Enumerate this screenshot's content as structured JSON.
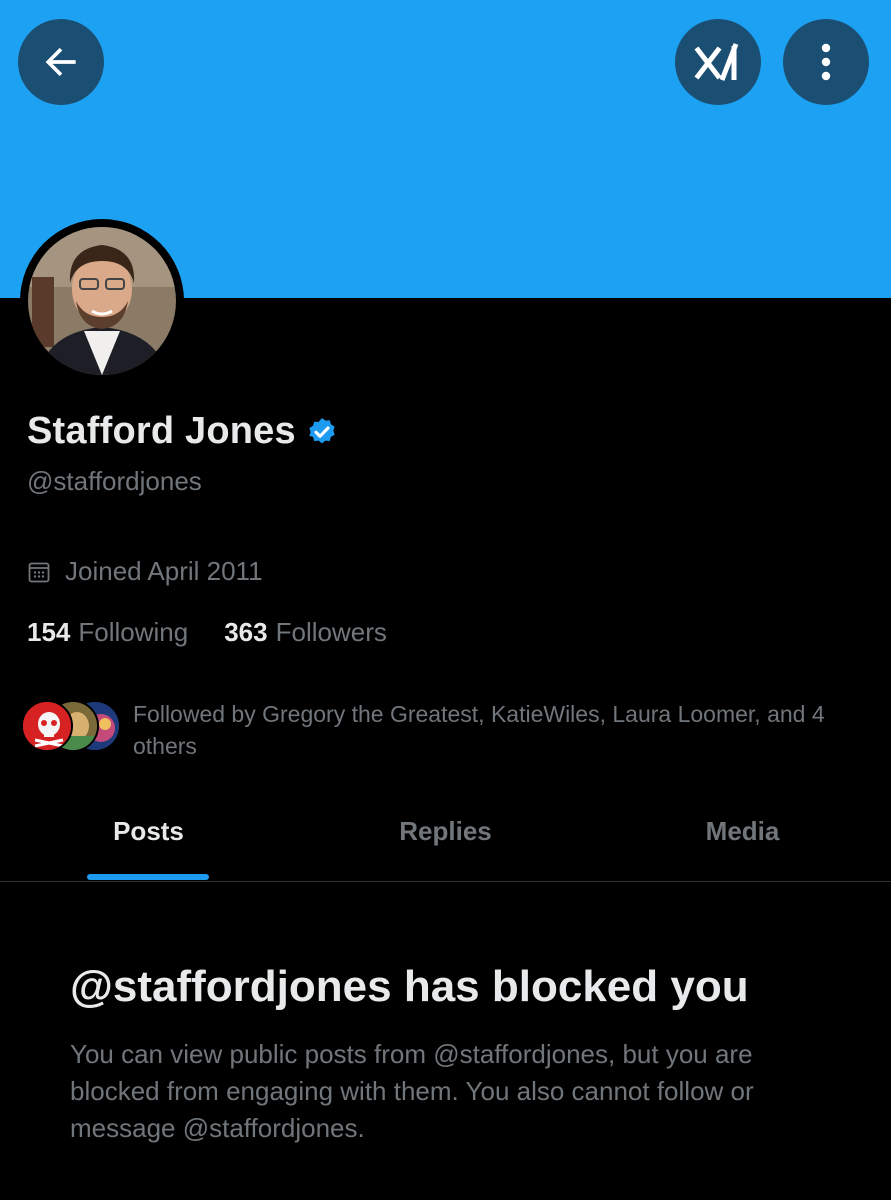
{
  "header": {
    "back_icon": "arrow-left-icon",
    "grok_icon": "grok-icon",
    "more_icon": "more-vertical-icon",
    "banner_color": "#1da1f2"
  },
  "profile": {
    "display_name": "Stafford Jones",
    "verified": true,
    "verified_color": "#1d9bf0",
    "handle": "@staffordjones",
    "joined_icon": "calendar-icon",
    "joined": "Joined April 2011",
    "following_count": "154",
    "following_label": "Following",
    "followers_count": "363",
    "followers_label": "Followers",
    "followed_by_text": "Followed by Gregory the Greatest, KatieWiles, Laura Loomer, and 4 others"
  },
  "tabs": [
    {
      "label": "Posts",
      "active": true
    },
    {
      "label": "Replies",
      "active": false
    },
    {
      "label": "Media",
      "active": false
    }
  ],
  "blocked": {
    "title": "@staffordjones has blocked you",
    "message": "You can view public posts from @staffordjones, but you are blocked from engaging with them. You also cannot follow or message @staffordjones."
  },
  "colors": {
    "accent": "#1d9bf0",
    "muted_text": "#71767b",
    "primary_text": "#e7e9ea",
    "background": "#000000"
  }
}
